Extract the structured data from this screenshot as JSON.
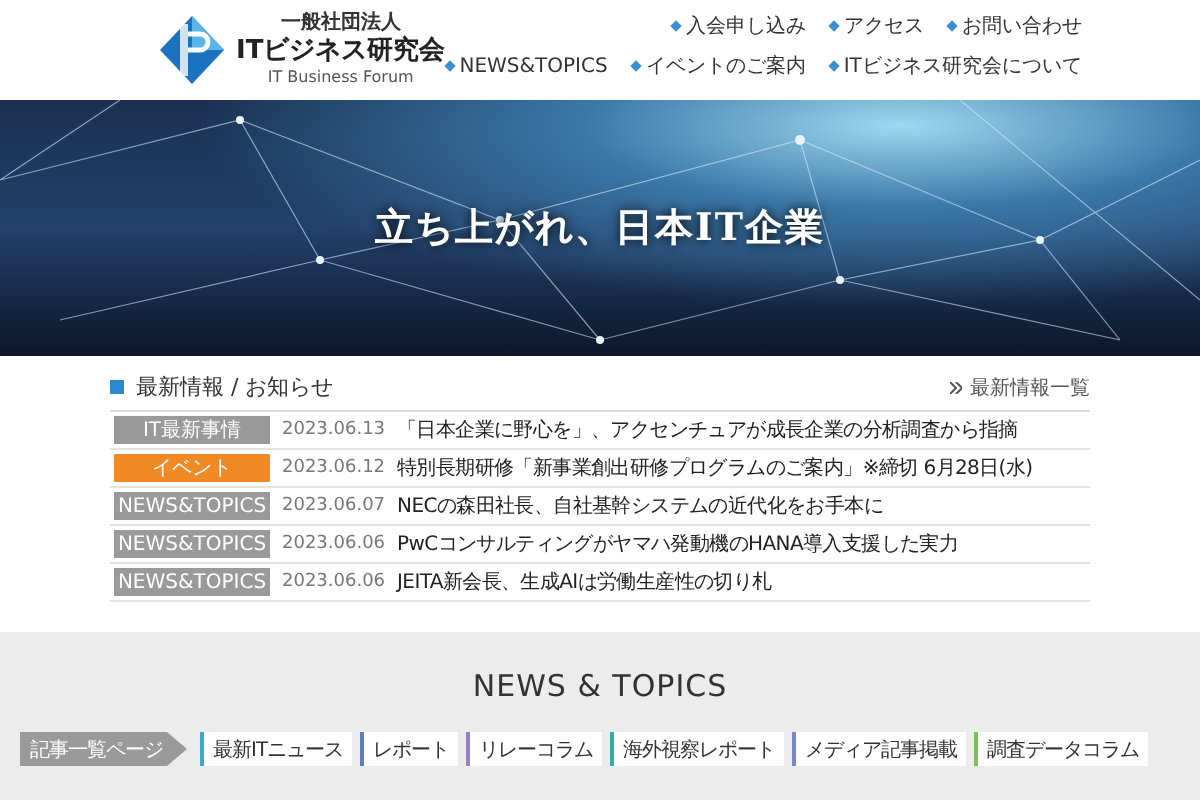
{
  "header": {
    "logo_subtitle": "一般社団法人",
    "logo_title": "ITビジネス研究会",
    "logo_english": "IT Business Forum",
    "utility_links": [
      "入会申し込み",
      "アクセス",
      "お問い合わせ"
    ],
    "nav": [
      "NEWS&TOPICS",
      "イベントのご案内",
      "ITビジネス研究会について"
    ]
  },
  "hero": {
    "headline": "立ち上がれ、日本IT企業"
  },
  "news": {
    "title": "最新情報 / お知らせ",
    "more_link": "最新情報一覧",
    "items": [
      {
        "tag": "IT最新事情",
        "color": "#9a9a9a",
        "date": "2023.06.13",
        "text": "「日本企業に野心を」、アクセンチュアが成長企業の分析調査から指摘"
      },
      {
        "tag": "イベント",
        "color": "#f08a24",
        "date": "2023.06.12",
        "text": "特別長期研修「新事業創出研修プログラムのご案内」※締切 6月28日(水)"
      },
      {
        "tag": "NEWS&TOPICS",
        "color": "#9a9a9a",
        "date": "2023.06.07",
        "text": "NECの森田社長、自社基幹システムの近代化をお手本に"
      },
      {
        "tag": "NEWS&TOPICS",
        "color": "#9a9a9a",
        "date": "2023.06.06",
        "text": "PwCコンサルティングがヤマハ発動機のHANA導入支援した実力"
      },
      {
        "tag": "NEWS&TOPICS",
        "color": "#9a9a9a",
        "date": "2023.06.06",
        "text": "JEITA新会長、生成AIは労働生産性の切り札"
      }
    ]
  },
  "topics": {
    "title": "NEWS & TOPICS",
    "index_button": "記事一覧ページ",
    "categories": [
      {
        "label": "最新ITニュース",
        "color": "#3fa9c9"
      },
      {
        "label": "レポート",
        "color": "#5b7fc0"
      },
      {
        "label": "リレーコラム",
        "color": "#9b7fc6"
      },
      {
        "label": "海外視察レポート",
        "color": "#2fb0a0"
      },
      {
        "label": "メディア記事掲載",
        "color": "#7b86d0"
      },
      {
        "label": "調査データコラム",
        "color": "#7cc05a"
      }
    ]
  }
}
